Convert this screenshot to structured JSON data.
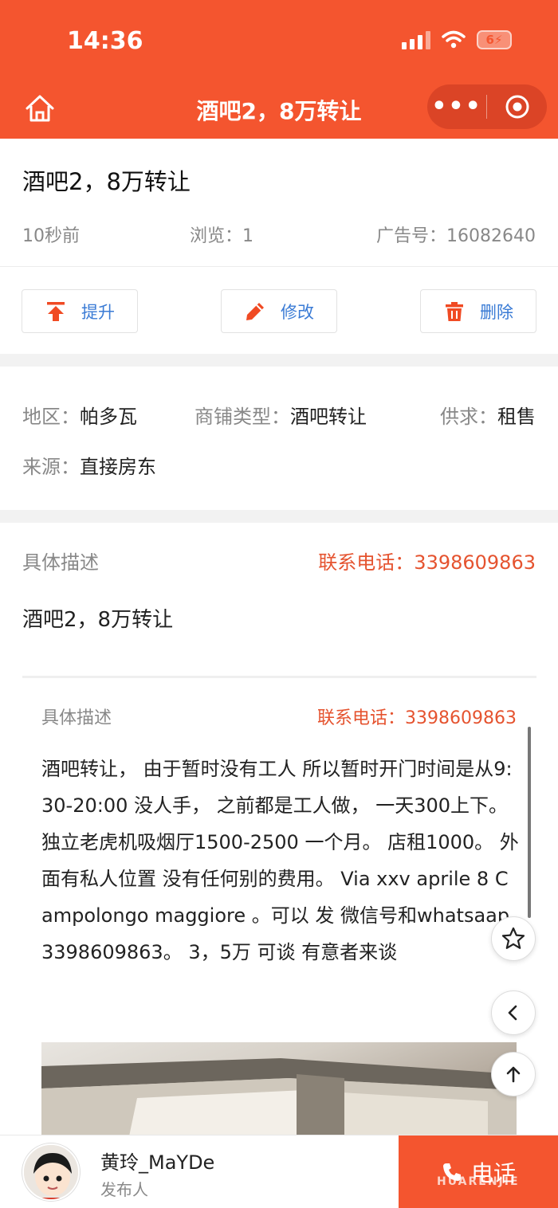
{
  "status_bar": {
    "time": "14:36",
    "battery": "6"
  },
  "nav": {
    "title": "酒吧2，8万转让",
    "more": "•••"
  },
  "ad": {
    "title": "酒吧2，8万转让",
    "posted": "10秒前",
    "views": "浏览：1",
    "ad_number": "广告号：16082640"
  },
  "actions": [
    {
      "label": "提升",
      "icon": "arrow-up-to-line-icon"
    },
    {
      "label": "修改",
      "icon": "pencil-icon"
    },
    {
      "label": "删除",
      "icon": "trash-icon"
    }
  ],
  "attributes": {
    "region_label": "地区：",
    "region_value": "帕多瓦",
    "type_label": "商铺类型：",
    "type_value": "酒吧转让",
    "supply_label": "供求：",
    "supply_value": "租售",
    "source_label": "来源：",
    "source_value": "直接房东"
  },
  "description": {
    "label": "具体描述",
    "phone": "联系电话：3398609863",
    "summary": "酒吧2，8万转让"
  },
  "detail": {
    "label": "具体描述",
    "phone": "联系电话：3398609863",
    "text": "酒吧转让， 由于暂时没有工人 所以暂时开门时间是从9:30-20:00 没人手， 之前都是工人做， 一天300上下。独立老虎机吸烟厅1500-2500 一个月。 店租1000。 外面有私人位置 没有任何别的费用。 Via xxv aprile 8 Campolongo maggiore 。可以 发 微信号和whatsaap 3398609863。 3，5万 可谈 有意者来谈"
  },
  "poster": {
    "name": "黄玲_MaYDe",
    "role": "发布人"
  },
  "call": {
    "label": "电话"
  },
  "watermark": "HUARENJIE",
  "colors": {
    "brand": "#f4552f",
    "link": "#3a7bd5",
    "phone": "#e5532f"
  }
}
